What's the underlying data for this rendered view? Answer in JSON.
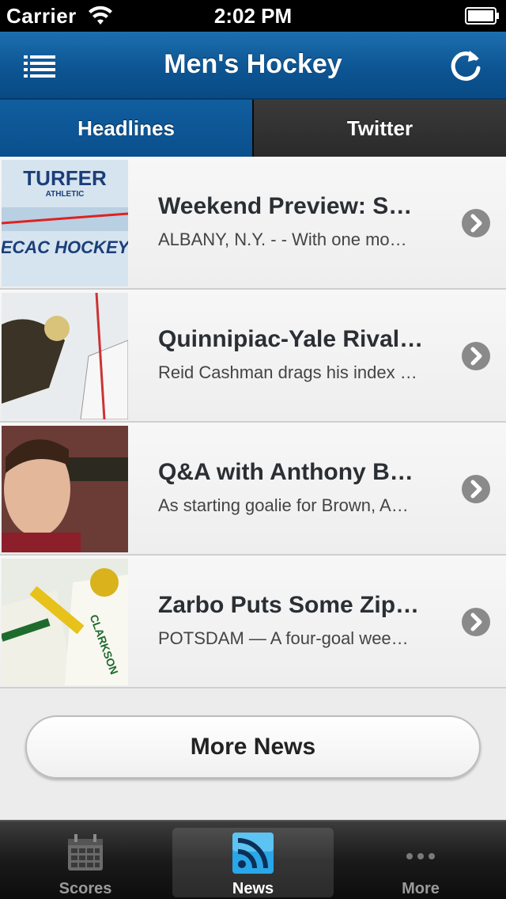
{
  "status_bar": {
    "carrier": "Carrier",
    "time": "2:02 PM"
  },
  "nav": {
    "title": "Men's Hockey"
  },
  "tabs": [
    {
      "label": "Headlines",
      "active": true
    },
    {
      "label": "Twitter",
      "active": false
    }
  ],
  "news": [
    {
      "title": "Weekend Preview: S…",
      "summary": "ALBANY, N.Y. - - With one mo…"
    },
    {
      "title": "Quinnipiac-Yale Rival…",
      "summary": "Reid Cashman drags his index …"
    },
    {
      "title": "Q&A with Anthony B…",
      "summary": "As starting goalie for Brown, A…"
    },
    {
      "title": "Zarbo Puts Some Zip…",
      "summary": "POTSDAM — A four-goal wee…"
    }
  ],
  "thumb_text": {
    "sponsor": "TURFER",
    "sponsor_sub": "ATHLETIC",
    "banner": "ECAC HOCKEY",
    "jersey": "CLARKSON"
  },
  "more_news_label": "More News",
  "tab_bar": [
    {
      "label": "Scores",
      "icon": "calendar-icon"
    },
    {
      "label": "News",
      "icon": "rss-icon",
      "selected": true
    },
    {
      "label": "More",
      "icon": "more-dots-icon"
    }
  ],
  "colors": {
    "nav_blue": "#0d5593",
    "tab_bar": "#1a1a1a",
    "accent_rss": "#2aa7e8"
  }
}
